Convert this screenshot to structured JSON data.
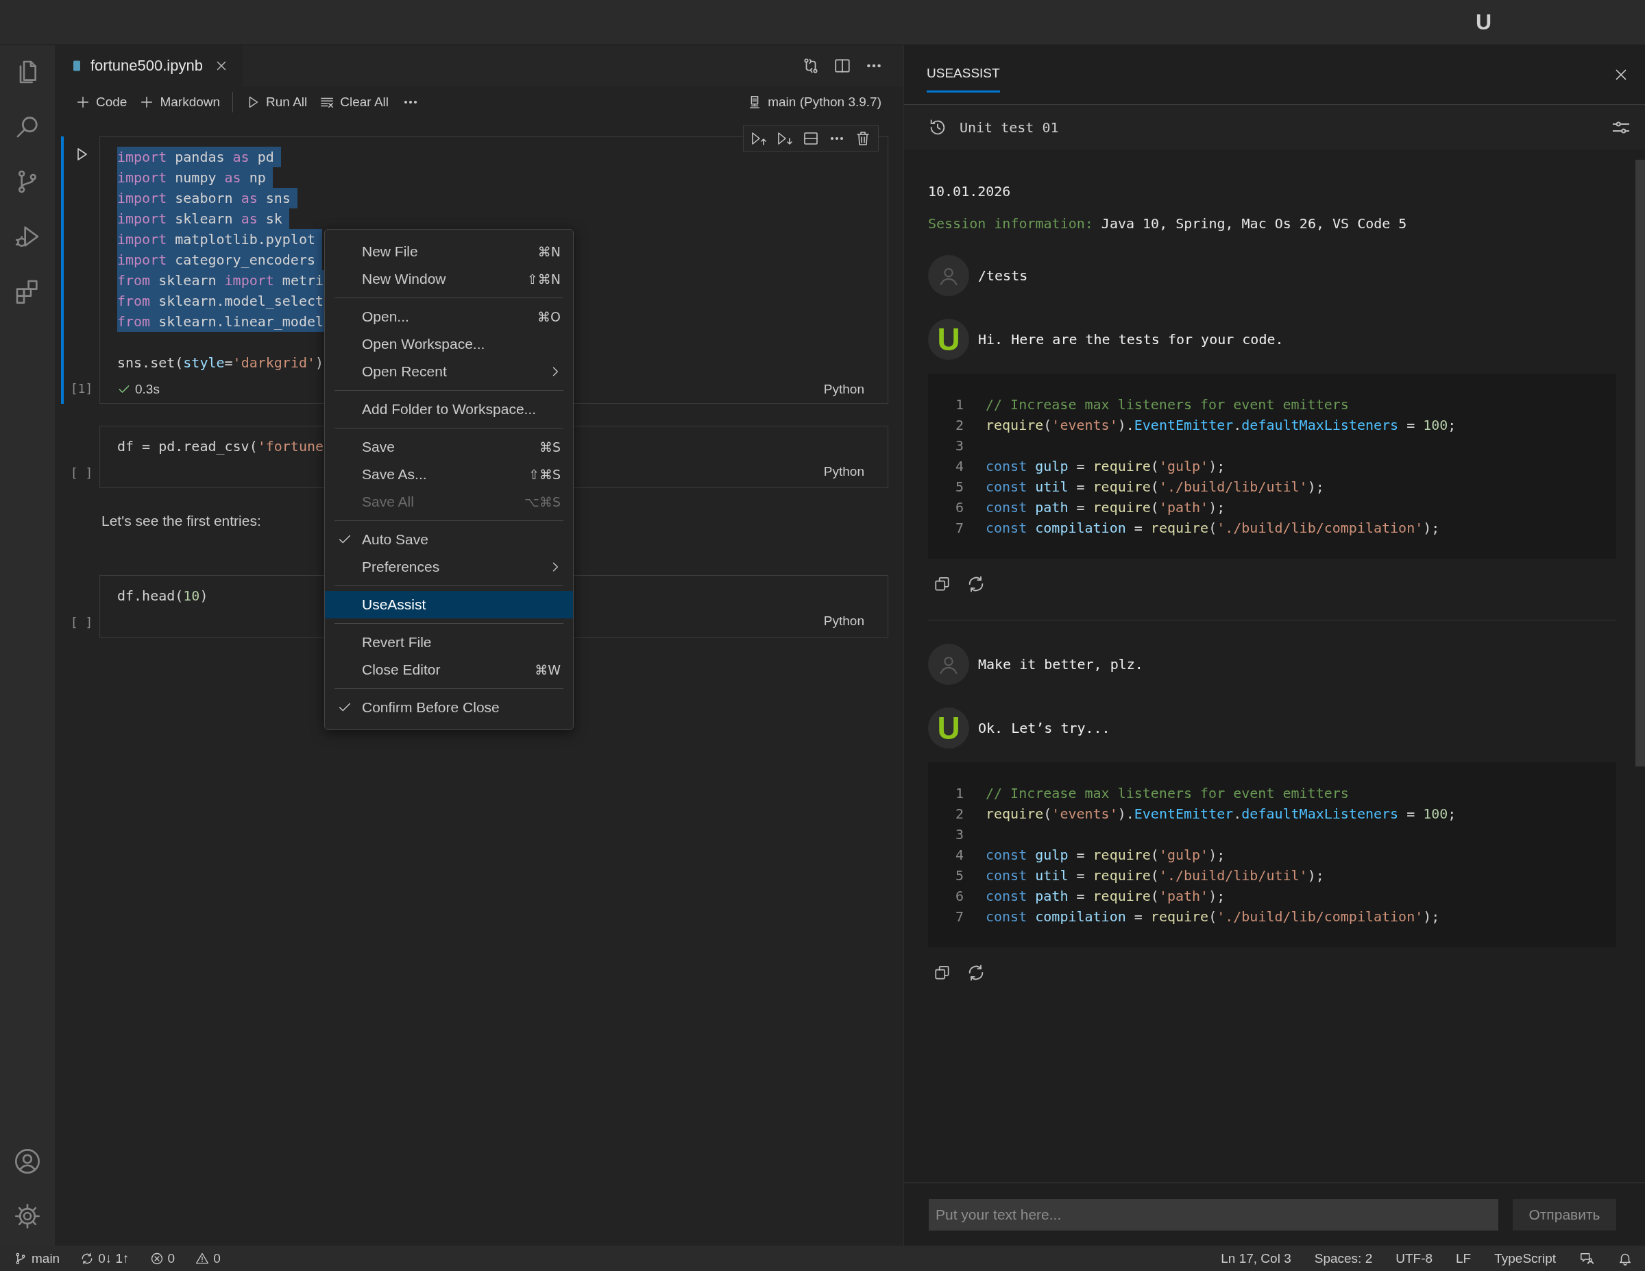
{
  "title_bar": {
    "logo": "U"
  },
  "editor": {
    "tab_title": "fortune500.ipynb",
    "toolbar": {
      "actions": [
        {
          "kind": "add",
          "label": "Code"
        },
        {
          "kind": "add",
          "label": "Markdown"
        },
        {
          "kind": "run",
          "label": "Run All"
        },
        {
          "kind": "clear",
          "label": "Clear All"
        }
      ],
      "kernel": "main (Python 3.9.7)"
    },
    "cells": [
      {
        "kind": "code",
        "focused": true,
        "count": "[1]",
        "status": "0.3s",
        "language": "Python",
        "lines": [
          {
            "selected": true,
            "tokens": [
              {
                "kind": "kw",
                "text": "import"
              },
              {
                "kind": "plain",
                "text": " pandas "
              },
              {
                "kind": "kw",
                "text": "as"
              },
              {
                "kind": "plain",
                "text": " pd"
              }
            ]
          },
          {
            "selected": true,
            "tokens": [
              {
                "kind": "kw",
                "text": "import"
              },
              {
                "kind": "plain",
                "text": " numpy "
              },
              {
                "kind": "kw",
                "text": "as"
              },
              {
                "kind": "plain",
                "text": " np"
              }
            ]
          },
          {
            "selected": true,
            "tokens": [
              {
                "kind": "kw",
                "text": "import"
              },
              {
                "kind": "plain",
                "text": " seaborn "
              },
              {
                "kind": "kw",
                "text": "as"
              },
              {
                "kind": "plain",
                "text": " sns"
              }
            ]
          },
          {
            "selected": true,
            "tokens": [
              {
                "kind": "kw",
                "text": "import"
              },
              {
                "kind": "plain",
                "text": " sklearn "
              },
              {
                "kind": "kw",
                "text": "as"
              },
              {
                "kind": "plain",
                "text": " sk"
              }
            ]
          },
          {
            "selected": true,
            "tokens": [
              {
                "kind": "kw",
                "text": "import"
              },
              {
                "kind": "plain",
                "text": " matplotlib.pyplot"
              }
            ]
          },
          {
            "selected": true,
            "tokens": [
              {
                "kind": "kw",
                "text": "import"
              },
              {
                "kind": "plain",
                "text": " category_encoders"
              }
            ]
          },
          {
            "selected": true,
            "tokens": [
              {
                "kind": "kw",
                "text": "from"
              },
              {
                "kind": "plain",
                "text": " sklearn "
              },
              {
                "kind": "kw",
                "text": "import"
              },
              {
                "kind": "plain",
                "text": " metri"
              }
            ]
          },
          {
            "selected": true,
            "tokens": [
              {
                "kind": "kw",
                "text": "from"
              },
              {
                "kind": "plain",
                "text": " sklearn.model_select"
              }
            ]
          },
          {
            "selected": true,
            "tokens": [
              {
                "kind": "kw",
                "text": "from"
              },
              {
                "kind": "plain",
                "text": " sklearn.linear_model"
              }
            ]
          },
          {
            "selected": false
          },
          {
            "selected": false,
            "tokens": [
              {
                "kind": "plain",
                "text": "sns.set("
              },
              {
                "kind": "var",
                "text": "style"
              },
              {
                "kind": "plain",
                "text": "="
              },
              {
                "kind": "str",
                "text": "'darkgrid'"
              },
              {
                "kind": "plain",
                "text": ")"
              }
            ]
          }
        ]
      },
      {
        "kind": "code",
        "focused": false,
        "count": "[ ]",
        "language": "Python",
        "lines": [
          {
            "selected": false,
            "tokens": [
              {
                "kind": "plain",
                "text": "df = pd.read_csv("
              },
              {
                "kind": "str",
                "text": "'fortune"
              }
            ]
          }
        ]
      },
      {
        "kind": "markdown",
        "text": "Let's see the first entries:"
      },
      {
        "kind": "code",
        "focused": false,
        "count": "[ ]",
        "language": "Python",
        "lines": [
          {
            "selected": false,
            "tokens": [
              {
                "kind": "plain",
                "text": "df.head("
              },
              {
                "kind": "num",
                "text": "10"
              },
              {
                "kind": "plain",
                "text": ")"
              }
            ]
          }
        ]
      }
    ]
  },
  "menu": {
    "groups": [
      [
        {
          "label": "New File",
          "shortcut": "⌘N",
          "checked": false,
          "disabled": false,
          "submenu": false,
          "selected": false
        },
        {
          "label": "New Window",
          "shortcut": "⇧⌘N",
          "checked": false,
          "disabled": false,
          "submenu": false,
          "selected": false
        }
      ],
      [
        {
          "label": "Open...",
          "shortcut": "⌘O",
          "checked": false,
          "disabled": false,
          "submenu": false,
          "selected": false
        },
        {
          "label": "Open Workspace...",
          "checked": false,
          "disabled": false,
          "submenu": false,
          "selected": false
        },
        {
          "label": "Open Recent",
          "checked": false,
          "disabled": false,
          "submenu": true,
          "selected": false
        }
      ],
      [
        {
          "label": "Add Folder to Workspace...",
          "checked": false,
          "disabled": false,
          "submenu": false,
          "selected": false
        }
      ],
      [
        {
          "label": "Save",
          "shortcut": "⌘S",
          "checked": false,
          "disabled": false,
          "submenu": false,
          "selected": false
        },
        {
          "label": "Save As...",
          "shortcut": "⇧⌘S",
          "checked": false,
          "disabled": false,
          "submenu": false,
          "selected": false
        },
        {
          "label": "Save All",
          "shortcut": "⌥⌘S",
          "checked": false,
          "disabled": true,
          "submenu": false,
          "selected": false
        }
      ],
      [
        {
          "label": "Auto Save",
          "checked": true,
          "disabled": false,
          "submenu": false,
          "selected": false
        },
        {
          "label": "Preferences",
          "checked": false,
          "disabled": false,
          "submenu": true,
          "selected": false
        }
      ],
      [
        {
          "label": "UseAssist",
          "checked": false,
          "disabled": false,
          "submenu": false,
          "selected": true
        }
      ],
      [
        {
          "label": "Revert File",
          "checked": false,
          "disabled": false,
          "submenu": false,
          "selected": false
        },
        {
          "label": "Close Editor",
          "shortcut": "⌘W",
          "checked": false,
          "disabled": false,
          "submenu": false,
          "selected": false
        }
      ],
      [
        {
          "label": "Confirm Before Close",
          "checked": true,
          "disabled": false,
          "submenu": false,
          "selected": false
        }
      ]
    ]
  },
  "assistant_panel": {
    "title": "USEASSIST",
    "session": "Unit test 01",
    "date": "10.01.2026",
    "session_info": {
      "label": "Session information:",
      "value": "Java 10, Spring, Mac Os 26, VS Code 5"
    },
    "messages": [
      {
        "kind": "user",
        "text": "/tests"
      },
      {
        "kind": "bot",
        "avatar": "U",
        "text": "Hi. Here are the tests for your code.",
        "code": [
          {
            "number": "1",
            "tokens": [
              {
                "kind": "comment",
                "text": "// Increase max listeners for event emitters"
              }
            ]
          },
          {
            "number": "2",
            "tokens": [
              {
                "kind": "fn",
                "text": "require"
              },
              {
                "kind": "plain",
                "text": "("
              },
              {
                "kind": "str",
                "text": "'events'"
              },
              {
                "kind": "plain",
                "text": ")."
              },
              {
                "kind": "type",
                "text": "EventEmitter"
              },
              {
                "kind": "plain",
                "text": "."
              },
              {
                "kind": "type",
                "text": "defaultMaxListeners"
              },
              {
                "kind": "plain",
                "text": " = "
              },
              {
                "kind": "num",
                "text": "100"
              },
              {
                "kind": "plain",
                "text": ";"
              }
            ]
          },
          {
            "number": "3"
          },
          {
            "number": "4",
            "tokens": [
              {
                "kind": "storage",
                "text": "const"
              },
              {
                "kind": "var",
                "text": " gulp"
              },
              {
                "kind": "plain",
                "text": " = "
              },
              {
                "kind": "fn",
                "text": "require"
              },
              {
                "kind": "plain",
                "text": "("
              },
              {
                "kind": "str",
                "text": "'gulp'"
              },
              {
                "kind": "plain",
                "text": ");"
              }
            ]
          },
          {
            "number": "5",
            "tokens": [
              {
                "kind": "storage",
                "text": "const"
              },
              {
                "kind": "var",
                "text": " util"
              },
              {
                "kind": "plain",
                "text": " = "
              },
              {
                "kind": "fn",
                "text": "require"
              },
              {
                "kind": "plain",
                "text": "("
              },
              {
                "kind": "str",
                "text": "'./build/lib/util'"
              },
              {
                "kind": "plain",
                "text": ");"
              }
            ]
          },
          {
            "number": "6",
            "tokens": [
              {
                "kind": "storage",
                "text": "const"
              },
              {
                "kind": "var",
                "text": " path"
              },
              {
                "kind": "plain",
                "text": " = "
              },
              {
                "kind": "fn",
                "text": "require"
              },
              {
                "kind": "plain",
                "text": "("
              },
              {
                "kind": "str",
                "text": "'path'"
              },
              {
                "kind": "plain",
                "text": ");"
              }
            ]
          },
          {
            "number": "7",
            "tokens": [
              {
                "kind": "storage",
                "text": "const"
              },
              {
                "kind": "var",
                "text": " compilation"
              },
              {
                "kind": "plain",
                "text": " = "
              },
              {
                "kind": "fn",
                "text": "require"
              },
              {
                "kind": "plain",
                "text": "("
              },
              {
                "kind": "str",
                "text": "'./build/lib/compilation'"
              },
              {
                "kind": "plain",
                "text": ");"
              }
            ]
          }
        ]
      },
      {
        "kind": "user",
        "text": "Make it better, plz."
      },
      {
        "kind": "bot",
        "avatar": "U",
        "text": "Ok. Let’s try...",
        "code": [
          {
            "number": "1",
            "tokens": [
              {
                "kind": "comment",
                "text": "// Increase max listeners for event emitters"
              }
            ]
          },
          {
            "number": "2",
            "tokens": [
              {
                "kind": "fn",
                "text": "require"
              },
              {
                "kind": "plain",
                "text": "("
              },
              {
                "kind": "str",
                "text": "'events'"
              },
              {
                "kind": "plain",
                "text": ")."
              },
              {
                "kind": "type",
                "text": "EventEmitter"
              },
              {
                "kind": "plain",
                "text": "."
              },
              {
                "kind": "type",
                "text": "defaultMaxListeners"
              },
              {
                "kind": "plain",
                "text": " = "
              },
              {
                "kind": "num",
                "text": "100"
              },
              {
                "kind": "plain",
                "text": ";"
              }
            ]
          },
          {
            "number": "3"
          },
          {
            "number": "4",
            "tokens": [
              {
                "kind": "storage",
                "text": "const"
              },
              {
                "kind": "var",
                "text": " gulp"
              },
              {
                "kind": "plain",
                "text": " = "
              },
              {
                "kind": "fn",
                "text": "require"
              },
              {
                "kind": "plain",
                "text": "("
              },
              {
                "kind": "str",
                "text": "'gulp'"
              },
              {
                "kind": "plain",
                "text": ");"
              }
            ]
          },
          {
            "number": "5",
            "tokens": [
              {
                "kind": "storage",
                "text": "const"
              },
              {
                "kind": "var",
                "text": " util"
              },
              {
                "kind": "plain",
                "text": " = "
              },
              {
                "kind": "fn",
                "text": "require"
              },
              {
                "kind": "plain",
                "text": "("
              },
              {
                "kind": "str",
                "text": "'./build/lib/util'"
              },
              {
                "kind": "plain",
                "text": ");"
              }
            ]
          },
          {
            "number": "6",
            "tokens": [
              {
                "kind": "storage",
                "text": "const"
              },
              {
                "kind": "var",
                "text": " path"
              },
              {
                "kind": "plain",
                "text": " = "
              },
              {
                "kind": "fn",
                "text": "require"
              },
              {
                "kind": "plain",
                "text": "("
              },
              {
                "kind": "str",
                "text": "'path'"
              },
              {
                "kind": "plain",
                "text": ");"
              }
            ]
          },
          {
            "number": "7",
            "tokens": [
              {
                "kind": "storage",
                "text": "const"
              },
              {
                "kind": "var",
                "text": " compilation"
              },
              {
                "kind": "plain",
                "text": " = "
              },
              {
                "kind": "fn",
                "text": "require"
              },
              {
                "kind": "plain",
                "text": "("
              },
              {
                "kind": "str",
                "text": "'./build/lib/compilation'"
              },
              {
                "kind": "plain",
                "text": ");"
              }
            ]
          }
        ]
      }
    ],
    "input": {
      "placeholder": "Put your text here..."
    },
    "send_button": "Отправить"
  },
  "status_bar": {
    "left": [
      {
        "kind": "branch",
        "text": "main"
      },
      {
        "kind": "sync",
        "text": "0↓ 1↑"
      },
      {
        "kind": "errors",
        "text": "0"
      },
      {
        "kind": "warnings",
        "text": "0"
      }
    ],
    "right": [
      {
        "kind": "text",
        "text": "Ln 17, Col 3"
      },
      {
        "kind": "text",
        "text": "Spaces: 2"
      },
      {
        "kind": "text",
        "text": "UTF-8"
      },
      {
        "kind": "text",
        "text": "LF"
      },
      {
        "kind": "text",
        "text": "TypeScript"
      },
      {
        "kind": "feedback"
      },
      {
        "kind": "bell"
      }
    ]
  }
}
